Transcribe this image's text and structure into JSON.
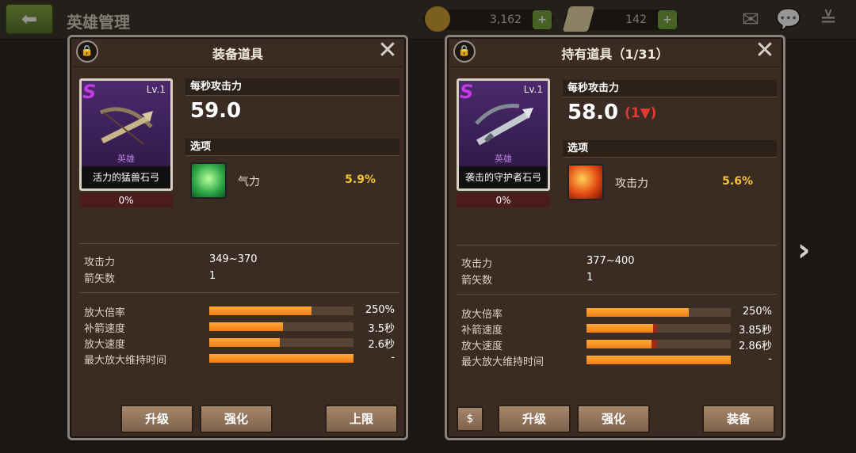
{
  "topbar": {
    "back_icon": "back-arrow-icon",
    "title": "英雄管理",
    "gold": "3,162",
    "tickets": "142",
    "plus": "+",
    "mail_icon": "mail-icon",
    "chat_icon": "chat-icon",
    "collapse_icon": "chevron-double-down-icon"
  },
  "left_panel": {
    "title": "装备道具",
    "lock_icon": "lock-icon",
    "close_icon": "close-icon",
    "close_glyph": "✕",
    "item": {
      "rank": "S",
      "level": "Lv.1",
      "grade": "英雄",
      "name": "活力的猛兽石弓",
      "progress": "0%"
    },
    "dps_label": "每秒攻击力",
    "dps_value": "59.0",
    "option_label": "选项",
    "option": {
      "icon": "stamina-icon",
      "name": "气力",
      "value": "5.9%"
    },
    "stats": [
      {
        "label": "攻击力",
        "value": "349~370"
      },
      {
        "label": "箭矢数",
        "value": "1"
      }
    ],
    "bars": [
      {
        "label": "放大倍率",
        "fraction": 0.71,
        "value": "250%"
      },
      {
        "label": "补箭速度",
        "fraction": 0.51,
        "value": "3.5秒"
      },
      {
        "label": "放大速度",
        "fraction": 0.49,
        "value": "2.6秒"
      },
      {
        "label": "最大放大维持时间",
        "fraction": 1.0,
        "value": "-"
      }
    ],
    "buttons": {
      "upgrade": "升级",
      "enhance": "强化",
      "limit": "上限"
    }
  },
  "right_panel": {
    "title": "持有道具（1/31）",
    "lock_icon": "lock-icon",
    "close_icon": "close-icon",
    "close_glyph": "✕",
    "item": {
      "rank": "S",
      "level": "Lv.1",
      "grade": "英雄",
      "name": "袭击的守护者石弓",
      "progress": "0%"
    },
    "dps_label": "每秒攻击力",
    "dps_value": "58.0",
    "dps_delta": "(1▼)",
    "option_label": "选项",
    "option": {
      "icon": "attack-power-icon",
      "name": "攻击力",
      "value": "5.6%"
    },
    "stats": [
      {
        "label": "攻击力",
        "value": "377~400"
      },
      {
        "label": "箭矢数",
        "value": "1"
      }
    ],
    "bars": [
      {
        "label": "放大倍率",
        "fraction": 0.71,
        "loss": 0.0,
        "value": "250%"
      },
      {
        "label": "补箭速度",
        "fraction": 0.46,
        "loss": 0.03,
        "value": "3.85秒"
      },
      {
        "label": "放大速度",
        "fraction": 0.45,
        "loss": 0.04,
        "value": "2.86秒"
      },
      {
        "label": "最大放大维持时间",
        "fraction": 1.0,
        "loss": 0.0,
        "value": "-"
      }
    ],
    "buttons": {
      "sell_icon": "sell-coin-icon",
      "upgrade": "升级",
      "enhance": "强化",
      "equip": "装备"
    }
  },
  "navigation": {
    "next_icon": "chevron-right-icon",
    "next_glyph": "›"
  },
  "colors": {
    "bar_fill": "#f07f16",
    "bar_loss": "#a3281a",
    "option_value": "#f3c33c",
    "hero_grade": "#c53be3",
    "delta_down": "#e33a30"
  }
}
